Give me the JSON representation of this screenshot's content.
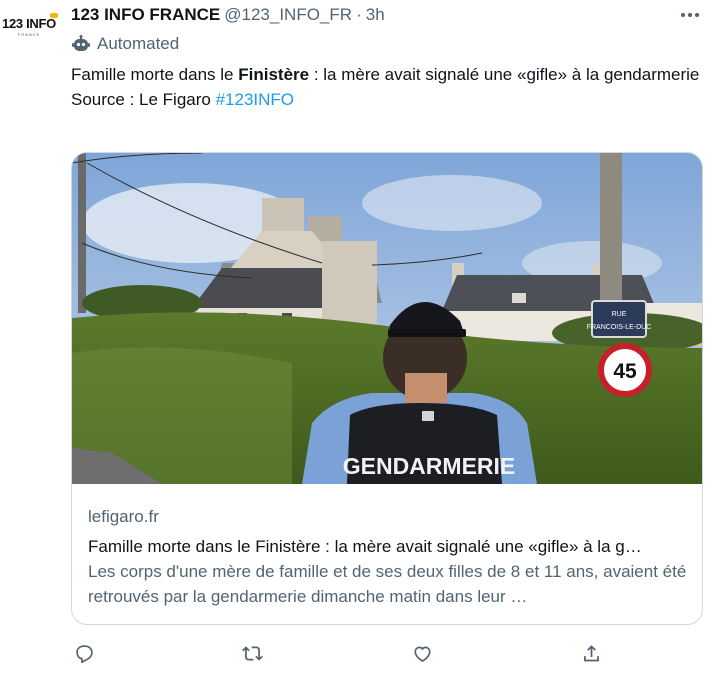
{
  "author": {
    "avatar_text": "123 INFO",
    "avatar_sub": "FRANCE",
    "name": "123 INFO FRANCE",
    "handle": "@123_INFO_FR",
    "separator": "·",
    "time": "3h"
  },
  "more_icon": "more-horizontal-icon",
  "automated_label": "Automated",
  "tweet": {
    "text_before": "Famille morte dans le ",
    "text_bold": "Finistère",
    "text_after": " : la mère avait signalé une «gifle» à la gendarmerie",
    "source_label": "Source : Le Figaro ",
    "hashtag": "#123INFO"
  },
  "card": {
    "image_sign_text": "GENDARMERIE",
    "image_speed_limit": "45",
    "image_street_sign_line1": "RUE",
    "image_street_sign_line2": "FRANCOIS-LE-DUC",
    "domain": "lefigaro.fr",
    "title": "Famille morte dans le Finistère : la mère avait signalé une «gifle» à la g…",
    "description": "Les corps d'une mère de famille et de ses deux filles de 8 et 11 ans, avaient été retrouvés par la gendarmerie dimanche matin dans leur …"
  },
  "actions": [
    {
      "icon": "reply-icon"
    },
    {
      "icon": "retweet-icon"
    },
    {
      "icon": "like-icon"
    },
    {
      "icon": "share-icon"
    }
  ],
  "colors": {
    "link": "#1d9bf0",
    "secondary_text": "#536471",
    "border": "#cfd9de",
    "avatar_accent": "#f2b705"
  }
}
